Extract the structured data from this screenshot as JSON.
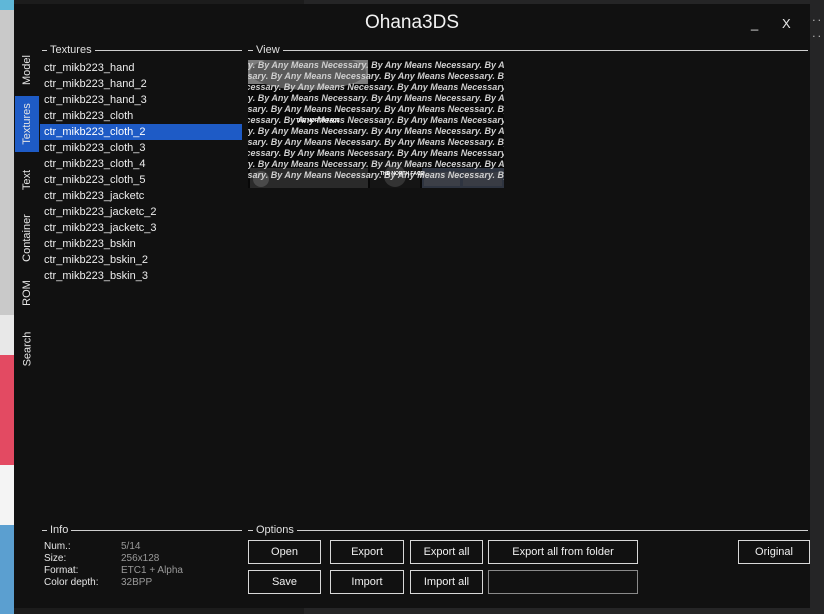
{
  "window": {
    "title": "Ohana3DS",
    "minimize_label": "_",
    "close_label": "X"
  },
  "background": {
    "right_text": [
      "p...",
      "p..."
    ]
  },
  "tabs": [
    {
      "label": "Model",
      "active": false
    },
    {
      "label": "Textures",
      "active": true
    },
    {
      "label": "Text",
      "active": false
    },
    {
      "label": "Container",
      "active": false
    },
    {
      "label": "ROM",
      "active": false
    },
    {
      "label": "Search",
      "active": false
    }
  ],
  "textures": {
    "group_label": "Textures",
    "selected_index": 4,
    "items": [
      "ctr_mikb223_hand",
      "ctr_mikb223_hand_2",
      "ctr_mikb223_hand_3",
      "ctr_mikb223_cloth",
      "ctr_mikb223_cloth_2",
      "ctr_mikb223_cloth_3",
      "ctr_mikb223_cloth_4",
      "ctr_mikb223_cloth_5",
      "ctr_mikb223_jacketc",
      "ctr_mikb223_jacketc_2",
      "ctr_mikb223_jacketc_3",
      "ctr_mikb223_bskin",
      "ctr_mikb223_bskin_2",
      "ctr_mikb223_bskin_3"
    ]
  },
  "view": {
    "group_label": "View",
    "texture_text": "Necessary. By Any Means",
    "logo_text": "THE NORTH FACE"
  },
  "info": {
    "group_label": "Info",
    "rows": [
      {
        "key": "Num.:",
        "value": "5/14"
      },
      {
        "key": "Size:",
        "value": "256x128"
      },
      {
        "key": "Format:",
        "value": "ETC1 + Alpha"
      },
      {
        "key": "Color depth:",
        "value": "32BPP"
      }
    ]
  },
  "options": {
    "group_label": "Options",
    "open": "Open",
    "save": "Save",
    "export": "Export",
    "import": "Import",
    "export_all": "Export all",
    "import_all": "Import all",
    "export_all_from_folder": "Export all from folder",
    "blank": "",
    "original": "Original"
  }
}
